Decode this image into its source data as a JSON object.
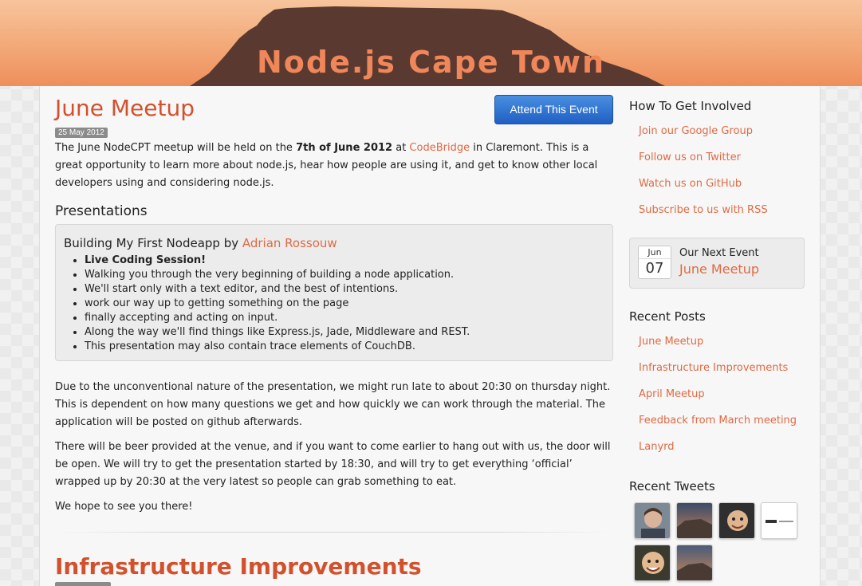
{
  "site": {
    "title": "Node.js Cape Town"
  },
  "post": {
    "title": "June Meetup",
    "date": "25 May 2012",
    "attend_label": "Attend This Event",
    "intro_1": "The June NodeCPT meetup will be held on the ",
    "intro_bold": "7th of June 2012",
    "intro_2": " at ",
    "intro_link": "CodeBridge",
    "intro_3": " in Claremont. This is a great opportunity to learn more about node.js, hear how people are using it, and get to know other local developers using and considering node.js.",
    "presentations_heading": "Presentations",
    "presentation": {
      "title": "Building My First Nodeapp by ",
      "speaker": "Adrian Rossouw",
      "items": [
        "Live Coding Session!",
        "Walking you through the very beginning of building a node application.",
        "We'll start only with a text editor, and the best of intentions.",
        "work our way up to getting something on the page",
        "finally accepting and acting on input.",
        "Along the way we'll find things like Express.js, Jade, Middleware and REST.",
        "This presentation may also contain trace elements of CouchDB."
      ]
    },
    "para_1": "Due to the unconventional nature of the presentation, we might run late to about 20:30 on thursday night. This is dependent on how many questions we get and how quickly we can work through the material. The application will be posted on github afterwards.",
    "para_2": "There will be beer provided at the venue, and if you want to come earlier to hang out with us, the door will be open. We will try to get the presentation started by 18:30, and will try to get everything ‘official’ wrapped up by 20:30 at the very latest so people can grab something to eat.",
    "para_3": "We hope to see you there!"
  },
  "next_post": {
    "title": "Infrastructure Improvements"
  },
  "sidebar": {
    "involved_heading": "How To Get Involved",
    "involved_links": [
      "Join our Google Group",
      "Follow us on Twitter",
      "Watch us on GitHub",
      "Subscribe to us with RSS"
    ],
    "next_event": {
      "month": "Jun",
      "day": "07",
      "label": "Our Next Event",
      "name": "June Meetup"
    },
    "recent_posts_heading": "Recent Posts",
    "recent_posts": [
      "June Meetup",
      "Infrastructure Improvements",
      "April Meetup",
      "Feedback from March meeting",
      "Lanyrd"
    ],
    "recent_tweets_heading": "Recent Tweets"
  },
  "colors": {
    "accent": "#e06a43",
    "title": "#d2512c",
    "button": "#2a6fd0",
    "header_top": "#f7c49c",
    "header_bottom": "#ee8f5c",
    "mountain": "#5a3a30"
  }
}
